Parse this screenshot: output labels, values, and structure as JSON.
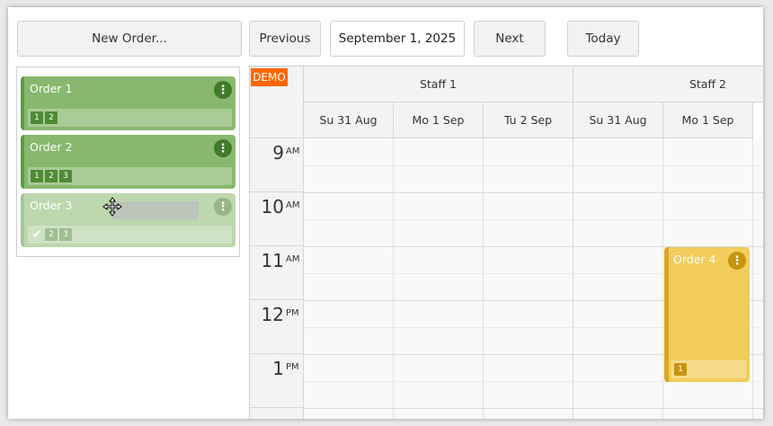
{
  "toolbar": {
    "new_order": "New Order...",
    "previous": "Previous",
    "date": "September 1, 2025",
    "next": "Next",
    "today": "Today"
  },
  "queue": {
    "orders": [
      {
        "title": "Order 1",
        "tags": [
          "1",
          "2"
        ]
      },
      {
        "title": "Order 2",
        "tags": [
          "1",
          "2",
          "3"
        ]
      },
      {
        "title": "Order 3",
        "tags": [
          "2",
          "3"
        ]
      }
    ]
  },
  "calendar": {
    "demo_label": "DEMO",
    "resources": [
      {
        "name": "Staff 1",
        "days": [
          "Su 31 Aug",
          "Mo 1 Sep",
          "Tu 2 Sep"
        ]
      },
      {
        "name": "Staff 2",
        "days": [
          "Su 31 Aug",
          "Mo 1 Sep"
        ]
      }
    ],
    "hours": [
      {
        "num": "9",
        "ampm": "AM"
      },
      {
        "num": "10",
        "ampm": "AM"
      },
      {
        "num": "11",
        "ampm": "AM"
      },
      {
        "num": "12",
        "ampm": "PM"
      },
      {
        "num": "1",
        "ampm": "PM"
      }
    ],
    "event": {
      "title": "Order 4",
      "tag": "1"
    }
  },
  "icons": {
    "menu": "more-vertical-icon",
    "check": "check-icon",
    "cursor": "move-cursor-icon"
  },
  "colors": {
    "order": "#88b86e",
    "order_accent": "#3f7b2a",
    "event": "#f2cc5c",
    "event_accent": "#c9950f",
    "demo": "#ff6600"
  }
}
